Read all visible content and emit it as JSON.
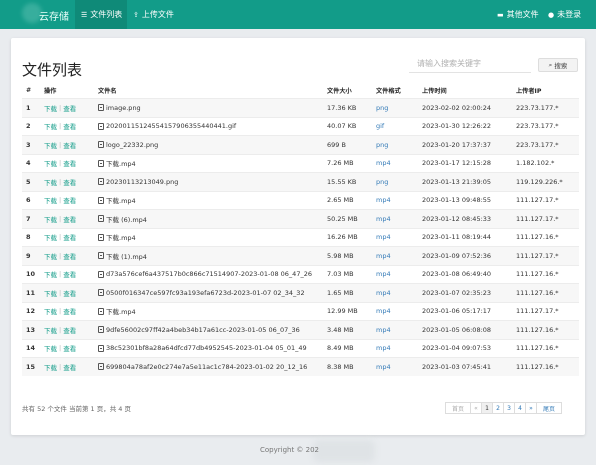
{
  "navbar": {
    "brand": "云存储",
    "items": [
      {
        "label": "文件列表",
        "icon": "list-icon"
      },
      {
        "label": "上传文件",
        "icon": "upload-icon"
      }
    ],
    "right": [
      {
        "label": "其他文件",
        "icon": "folder-icon"
      },
      {
        "label": "未登录",
        "icon": "user-icon"
      }
    ],
    "color": "#129c89"
  },
  "page": {
    "title": "文件列表",
    "search_placeholder": "请输入搜索关键字",
    "search_button": "搜索"
  },
  "table": {
    "columns": [
      "#",
      "操作",
      "文件名",
      "文件大小",
      "文件格式",
      "上传时间",
      "上传者IP"
    ],
    "op_download": "下载",
    "op_view": "查看",
    "rows": [
      {
        "idx": "1",
        "name": "image.png",
        "size": "17.36 KB",
        "fmt": "png",
        "time": "2023-02-02 02:00:24",
        "ip": "223.73.177.*"
      },
      {
        "idx": "2",
        "name": "20200115124554157906355440441.gif",
        "size": "40.07 KB",
        "fmt": "gif",
        "time": "2023-01-30 12:26:22",
        "ip": "223.73.177.*"
      },
      {
        "idx": "3",
        "name": "logo_22332.png",
        "size": "699 B",
        "fmt": "png",
        "time": "2023-01-20 17:37:37",
        "ip": "223.73.177.*"
      },
      {
        "idx": "4",
        "name": "下载.mp4",
        "size": "7.26 MB",
        "fmt": "mp4",
        "time": "2023-01-17 12:15:28",
        "ip": "1.182.102.*"
      },
      {
        "idx": "5",
        "name": "20230113213049.png",
        "size": "15.55 KB",
        "fmt": "png",
        "time": "2023-01-13 21:39:05",
        "ip": "119.129.226.*"
      },
      {
        "idx": "6",
        "name": "下载.mp4",
        "size": "2.65 MB",
        "fmt": "mp4",
        "time": "2023-01-13 09:48:55",
        "ip": "111.127.17.*"
      },
      {
        "idx": "7",
        "name": "下载 (6).mp4",
        "size": "50.25 MB",
        "fmt": "mp4",
        "time": "2023-01-12 08:45:33",
        "ip": "111.127.17.*"
      },
      {
        "idx": "8",
        "name": "下载.mp4",
        "size": "16.26 MB",
        "fmt": "mp4",
        "time": "2023-01-11 08:19:44",
        "ip": "111.127.16.*"
      },
      {
        "idx": "9",
        "name": "下载 (1).mp4",
        "size": "5.98 MB",
        "fmt": "mp4",
        "time": "2023-01-09 07:52:36",
        "ip": "111.127.17.*"
      },
      {
        "idx": "10",
        "name": "d73a576cef6a437517b0c866c71514907-2023-01-08 06_47_26",
        "size": "7.03 MB",
        "fmt": "mp4",
        "time": "2023-01-08 06:49:40",
        "ip": "111.127.16.*"
      },
      {
        "idx": "11",
        "name": "0500f016347ce597fc93a193efa6723d-2023-01-07 02_34_32",
        "size": "1.65 MB",
        "fmt": "mp4",
        "time": "2023-01-07 02:35:23",
        "ip": "111.127.16.*"
      },
      {
        "idx": "12",
        "name": "下载.mp4",
        "size": "12.99 MB",
        "fmt": "mp4",
        "time": "2023-01-06 05:17:17",
        "ip": "111.127.17.*"
      },
      {
        "idx": "13",
        "name": "9dfe56002c97ff42a4beb34b17a61cc-2023-01-05 06_07_36",
        "size": "3.48 MB",
        "fmt": "mp4",
        "time": "2023-01-05 06:08:08",
        "ip": "111.127.16.*"
      },
      {
        "idx": "14",
        "name": "38c52301bf8a28a64dfcd77db4952545-2023-01-04 05_01_49",
        "size": "8.49 MB",
        "fmt": "mp4",
        "time": "2023-01-04 09:07:53",
        "ip": "111.127.16.*"
      },
      {
        "idx": "15",
        "name": "699804a78af2e0c274e7a5e11ac1c784-2023-01-02 20_12_16",
        "size": "8.38 MB",
        "fmt": "mp4",
        "time": "2023-01-03 07:45:41",
        "ip": "111.127.16.*"
      }
    ]
  },
  "footer": {
    "summary": "共有 52 个文件 当前第 1 页，共 4 页",
    "pager": [
      "首页",
      "«",
      "1",
      "2",
      "3",
      "4",
      "»",
      "尾页"
    ],
    "copyright": "Copyright © 202"
  }
}
